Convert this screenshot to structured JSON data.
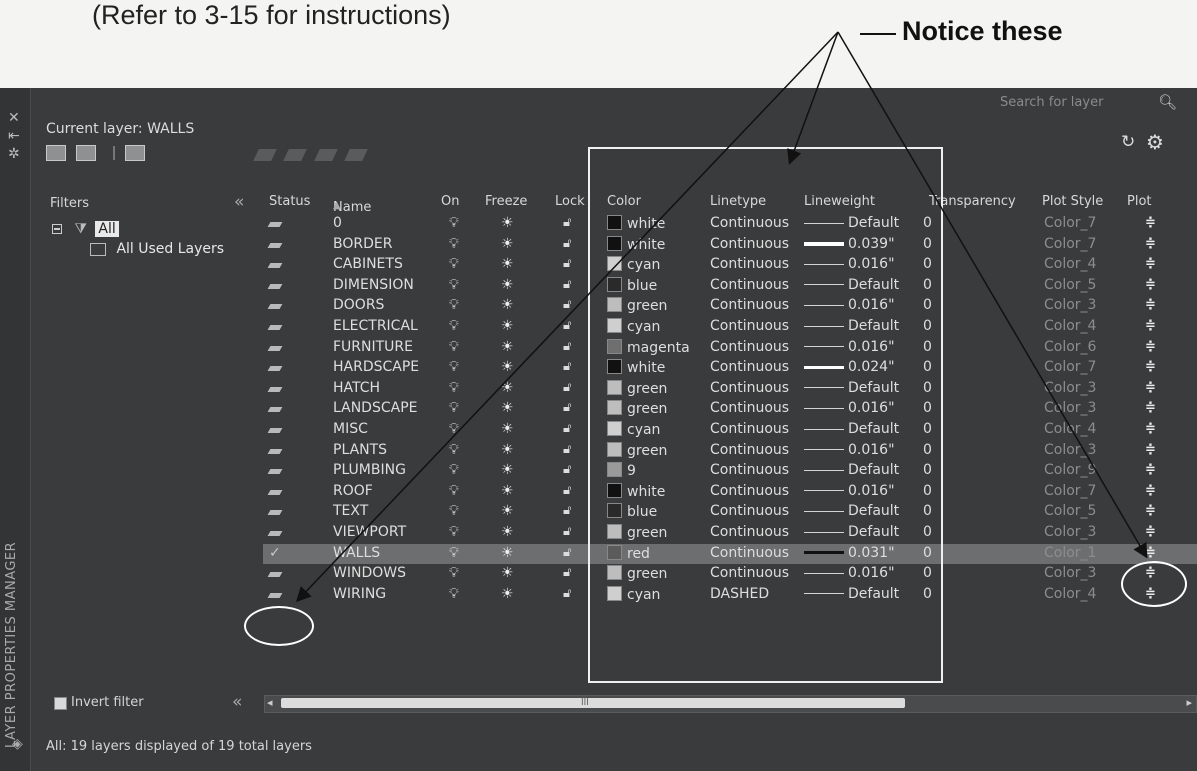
{
  "book": {
    "instruction": "(Refer to 3-15 for instructions)",
    "notice": "Notice these"
  },
  "panel": {
    "vertical_title": "LAYER PROPERTIES MANAGER",
    "current_layer": "Current layer: WALLS",
    "search_placeholder": "Search for layer",
    "filters_label": "Filters",
    "tree": {
      "root": "All",
      "child": "All Used Layers"
    },
    "invert_filter": "Invert filter",
    "status": "All: 19 layers displayed of 19 total layers"
  },
  "columns": {
    "status": "Status",
    "name": "Name",
    "on": "On",
    "freeze": "Freeze",
    "lock": "Lock",
    "color": "Color",
    "linetype": "Linetype",
    "lineweight": "Lineweight",
    "transparency": "Transparency",
    "plot_style": "Plot Style",
    "plot": "Plot"
  },
  "icons": {
    "on": "lightbulb-icon",
    "freeze": "sun-icon",
    "lock": "unlocked-padlock-icon",
    "plot": "printer-icon",
    "status": "layer-icon",
    "current_status": "checkmark-icon"
  },
  "colors": {
    "accent_highlight": "#6d6e6f",
    "panel_bg": "#3a3b3c",
    "annotation": "#ffffff"
  },
  "layers": [
    {
      "name": "0",
      "color": "white",
      "hex": "#111111",
      "linetype": "Continuous",
      "lw": "Default",
      "tr": "0",
      "ps": "Color_7",
      "current": false
    },
    {
      "name": "BORDER",
      "color": "white",
      "hex": "#111111",
      "linetype": "Continuous",
      "lw": "0.039\"",
      "tr": "0",
      "ps": "Color_7",
      "current": false
    },
    {
      "name": "CABINETS",
      "color": "cyan",
      "hex": "#cfcfcf",
      "linetype": "Continuous",
      "lw": "0.016\"",
      "tr": "0",
      "ps": "Color_4",
      "current": false
    },
    {
      "name": "DIMENSION",
      "color": "blue",
      "hex": "#2a2a2a",
      "linetype": "Continuous",
      "lw": "Default",
      "tr": "0",
      "ps": "Color_5",
      "current": false
    },
    {
      "name": "DOORS",
      "color": "green",
      "hex": "#bdbdbd",
      "linetype": "Continuous",
      "lw": "0.016\"",
      "tr": "0",
      "ps": "Color_3",
      "current": false
    },
    {
      "name": "ELECTRICAL",
      "color": "cyan",
      "hex": "#cfcfcf",
      "linetype": "Continuous",
      "lw": "Default",
      "tr": "0",
      "ps": "Color_4",
      "current": false
    },
    {
      "name": "FURNITURE",
      "color": "magenta",
      "hex": "#6f6f6f",
      "linetype": "Continuous",
      "lw": "0.016\"",
      "tr": "0",
      "ps": "Color_6",
      "current": false
    },
    {
      "name": "HARDSCAPE",
      "color": "white",
      "hex": "#111111",
      "linetype": "Continuous",
      "lw": "0.024\"",
      "tr": "0",
      "ps": "Color_7",
      "current": false
    },
    {
      "name": "HATCH",
      "color": "green",
      "hex": "#bdbdbd",
      "linetype": "Continuous",
      "lw": "Default",
      "tr": "0",
      "ps": "Color_3",
      "current": false
    },
    {
      "name": "LANDSCAPE",
      "color": "green",
      "hex": "#bdbdbd",
      "linetype": "Continuous",
      "lw": "0.016\"",
      "tr": "0",
      "ps": "Color_3",
      "current": false
    },
    {
      "name": "MISC",
      "color": "cyan",
      "hex": "#cfcfcf",
      "linetype": "Continuous",
      "lw": "Default",
      "tr": "0",
      "ps": "Color_4",
      "current": false
    },
    {
      "name": "PLANTS",
      "color": "green",
      "hex": "#bdbdbd",
      "linetype": "Continuous",
      "lw": "0.016\"",
      "tr": "0",
      "ps": "Color_3",
      "current": false
    },
    {
      "name": "PLUMBING",
      "color": "9",
      "hex": "#9a9a9a",
      "linetype": "Continuous",
      "lw": "Default",
      "tr": "0",
      "ps": "Color_9",
      "current": false
    },
    {
      "name": "ROOF",
      "color": "white",
      "hex": "#111111",
      "linetype": "Continuous",
      "lw": "0.016\"",
      "tr": "0",
      "ps": "Color_7",
      "current": false
    },
    {
      "name": "TEXT",
      "color": "blue",
      "hex": "#2a2a2a",
      "linetype": "Continuous",
      "lw": "Default",
      "tr": "0",
      "ps": "Color_5",
      "current": false
    },
    {
      "name": "VIEWPORT",
      "color": "green",
      "hex": "#bdbdbd",
      "linetype": "Continuous",
      "lw": "Default",
      "tr": "0",
      "ps": "Color_3",
      "current": false
    },
    {
      "name": "WALLS",
      "color": "red",
      "hex": "#5b5b5b",
      "linetype": "Continuous",
      "lw": "0.031\"",
      "tr": "0",
      "ps": "Color_1",
      "current": true
    },
    {
      "name": "WINDOWS",
      "color": "green",
      "hex": "#bdbdbd",
      "linetype": "Continuous",
      "lw": "0.016\"",
      "tr": "0",
      "ps": "Color_3",
      "current": false
    },
    {
      "name": "WIRING",
      "color": "cyan",
      "hex": "#cfcfcf",
      "linetype": "DASHED",
      "lw": "Default",
      "tr": "0",
      "ps": "Color_4",
      "current": false
    }
  ]
}
